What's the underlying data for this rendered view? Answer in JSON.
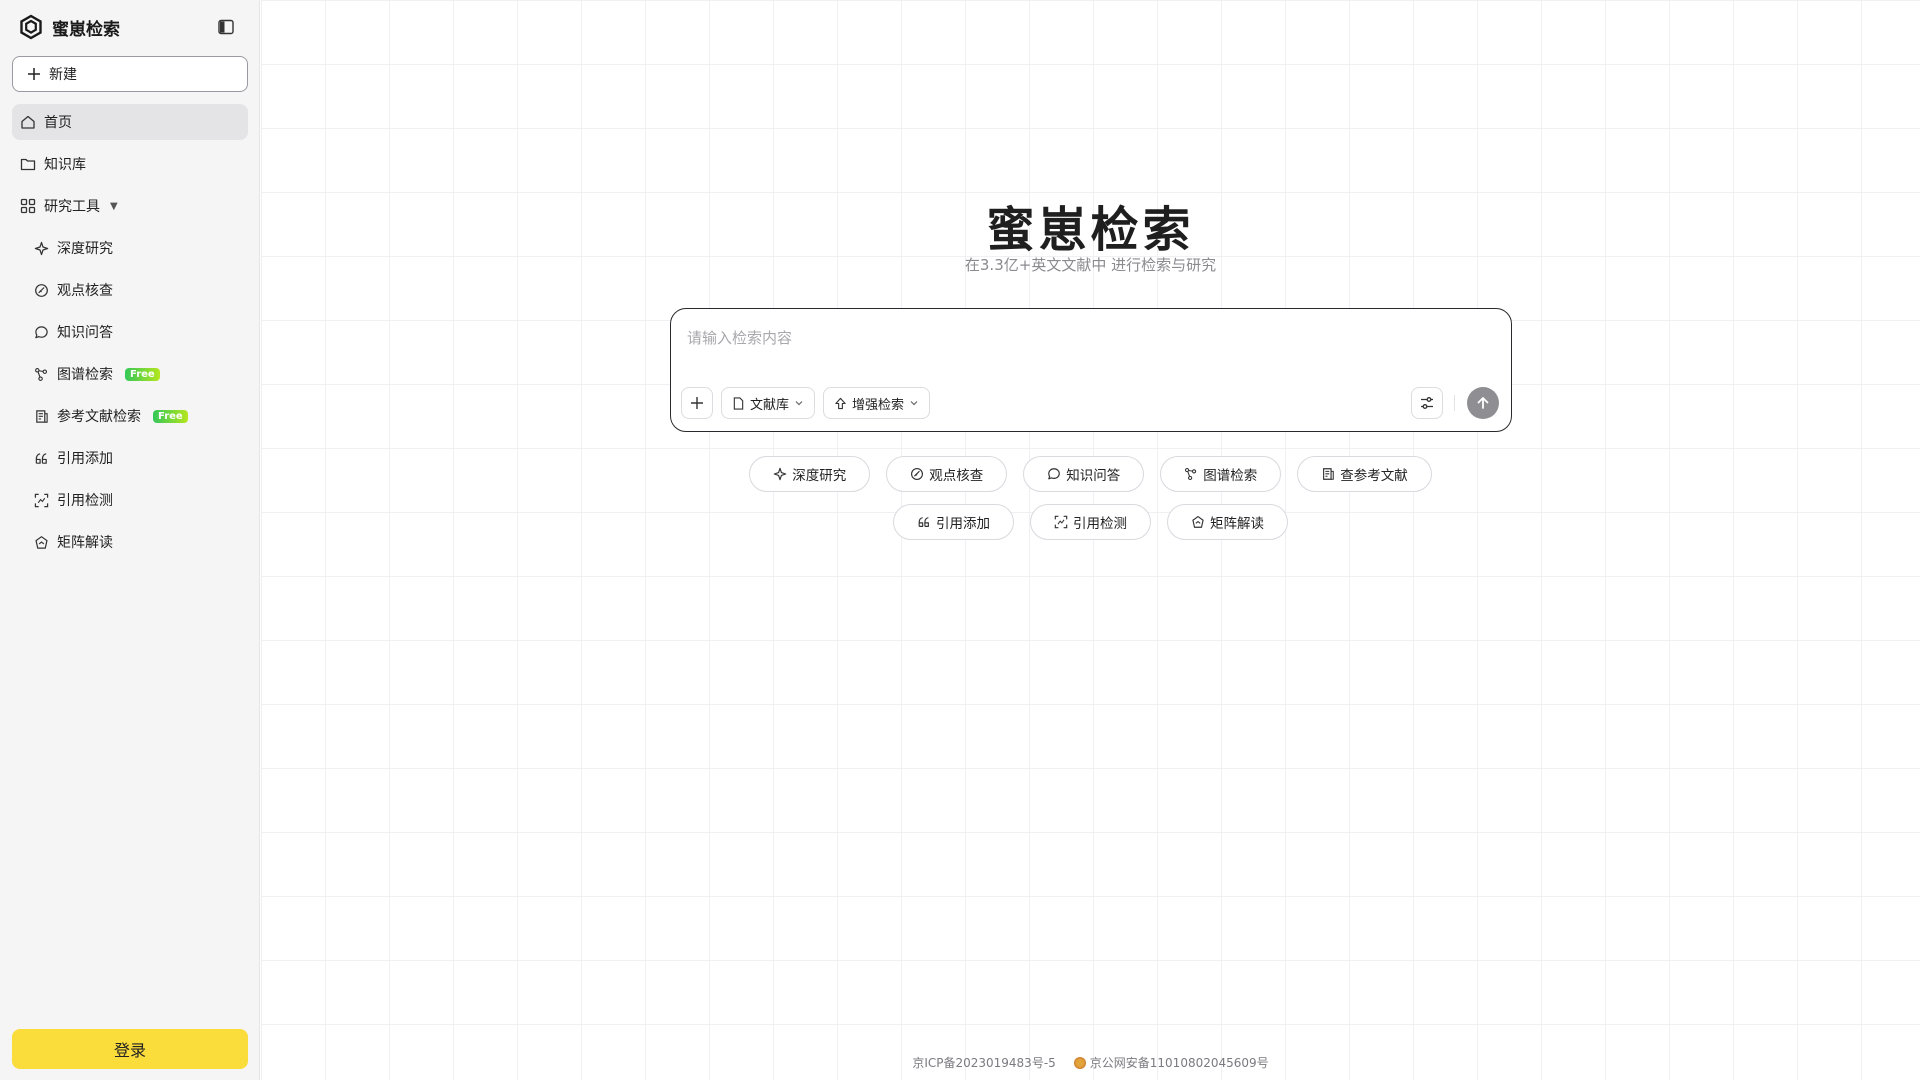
{
  "brand": {
    "name": "蜜崽检索"
  },
  "sidebar": {
    "new_label": "新建",
    "items": [
      {
        "label": "首页",
        "icon": "home-icon",
        "active": true
      },
      {
        "label": "知识库",
        "icon": "folder-icon"
      },
      {
        "label": "研究工具",
        "icon": "grid-icon",
        "caret": "▼"
      }
    ],
    "tools": [
      {
        "label": "深度研究",
        "icon": "sparkle-icon"
      },
      {
        "label": "观点核查",
        "icon": "check-link-icon"
      },
      {
        "label": "知识问答",
        "icon": "chat-icon"
      },
      {
        "label": "图谱检索",
        "icon": "graph-icon",
        "badge": "Free"
      },
      {
        "label": "参考文献检索",
        "icon": "reference-icon",
        "badge": "Free"
      },
      {
        "label": "引用添加",
        "icon": "quote-icon"
      },
      {
        "label": "引用检测",
        "icon": "scan-icon"
      },
      {
        "label": "矩阵解读",
        "icon": "matrix-icon"
      }
    ],
    "login_label": "登录"
  },
  "hero": {
    "title": "蜜崽检索",
    "subtitle": "在3.3亿+英文文献中 进行检索与研究"
  },
  "search": {
    "placeholder": "请输入检索内容",
    "library_label": "文献库",
    "enhance_label": "增强检索"
  },
  "chips_row1": [
    {
      "label": "深度研究",
      "icon": "sparkle-icon"
    },
    {
      "label": "观点核查",
      "icon": "check-link-icon"
    },
    {
      "label": "知识问答",
      "icon": "chat-icon"
    },
    {
      "label": "图谱检索",
      "icon": "graph-icon"
    },
    {
      "label": "查参考文献",
      "icon": "reference-icon"
    }
  ],
  "chips_row2": [
    {
      "label": "引用添加",
      "icon": "quote-icon"
    },
    {
      "label": "引用检测",
      "icon": "scan-icon"
    },
    {
      "label": "矩阵解读",
      "icon": "matrix-icon"
    }
  ],
  "footer": {
    "icp": "京ICP备2023019483号-5",
    "police": "京公网安备11010802045609号"
  },
  "colors": {
    "accent": "#fadc3b",
    "send": "#8e8e93",
    "badge_start": "#34c759",
    "badge_end": "#b5e61d"
  }
}
